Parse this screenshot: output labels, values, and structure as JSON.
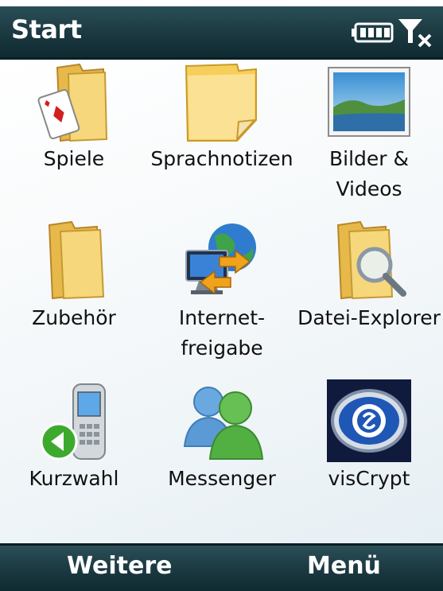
{
  "titlebar": {
    "title": "Start"
  },
  "status_icons": [
    "battery-icon",
    "signal-no-service-icon"
  ],
  "apps": [
    {
      "label_lines": [
        "Spiele"
      ],
      "icon": "games-folder-icon"
    },
    {
      "label_lines": [
        "Sprachnotizen"
      ],
      "icon": "voice-notes-icon"
    },
    {
      "label_lines": [
        "Bilder &",
        "Videos"
      ],
      "icon": "pictures-videos-icon"
    },
    {
      "label_lines": [
        "Zubehör"
      ],
      "icon": "accessories-folder-icon"
    },
    {
      "label_lines": [
        "Internet-",
        "freigabe"
      ],
      "icon": "internet-sharing-icon"
    },
    {
      "label_lines": [
        "Datei-Explorer"
      ],
      "icon": "file-explorer-icon"
    },
    {
      "label_lines": [
        "Kurzwahl"
      ],
      "icon": "speed-dial-icon"
    },
    {
      "label_lines": [
        "Messenger"
      ],
      "icon": "messenger-icon"
    },
    {
      "label_lines": [
        "visCrypt"
      ],
      "icon": "viscrypt-icon"
    }
  ],
  "softkeys": {
    "left": "Weitere",
    "right": "Menü"
  }
}
